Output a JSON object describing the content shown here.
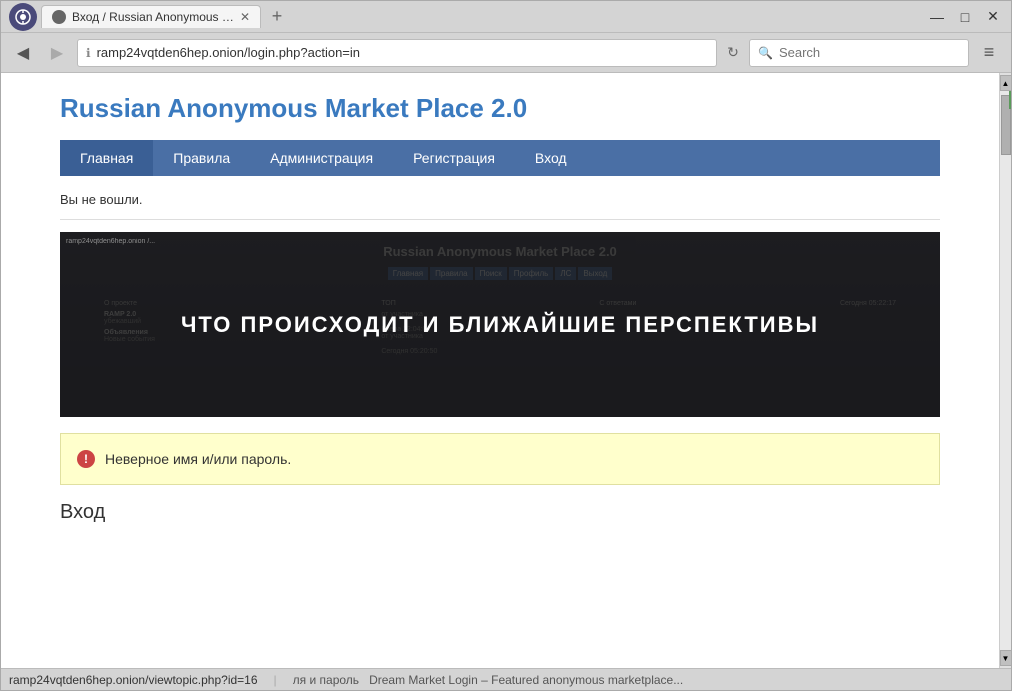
{
  "window": {
    "title": "Вход / Russian Anonymous M...",
    "minimize_label": "—",
    "maximize_label": "□",
    "close_label": "✕",
    "new_tab_label": "+"
  },
  "titlebar": {
    "tab_title": "Вход / Russian Anonymous M...",
    "close_btn": "✕"
  },
  "navbar": {
    "back_btn": "◀",
    "forward_btn": "▶",
    "info_icon": "ℹ",
    "address": "ramp24vqtden6hep.onion/login.php?action=in",
    "refresh_icon": "↻",
    "search_placeholder": "Search",
    "menu_icon": "≡"
  },
  "site": {
    "title": "Russian Anonymous Market Place 2.0",
    "nav": [
      {
        "label": "Главная",
        "active": false
      },
      {
        "label": "Правила",
        "active": false
      },
      {
        "label": "Администрация",
        "active": false
      },
      {
        "label": "Регистрация",
        "active": false
      },
      {
        "label": "Вход",
        "active": false
      }
    ],
    "status_message": "Вы не вошли.",
    "banner_title": "Russian Anonymous Market Place 2.0",
    "banner_nav_items": [
      "Главная",
      "Правила",
      "Поиск",
      "Профиль",
      "ЛС",
      "Выход"
    ],
    "banner_text": "ЧТО ПРОИСХОДИТ И БЛИЖАЙШИЕ ПЕРСПЕКТИВЫ",
    "error": {
      "icon": "!",
      "message": "Неверное имя и/или пароль."
    },
    "login_section_title": "Вход"
  },
  "statusbar": {
    "url": "ramp24vqtden6hep.onion/viewtopic.php?id=16",
    "text1": "ля и пароль",
    "text2": "Dream Market Login – Featured anonymous marketplace..."
  }
}
